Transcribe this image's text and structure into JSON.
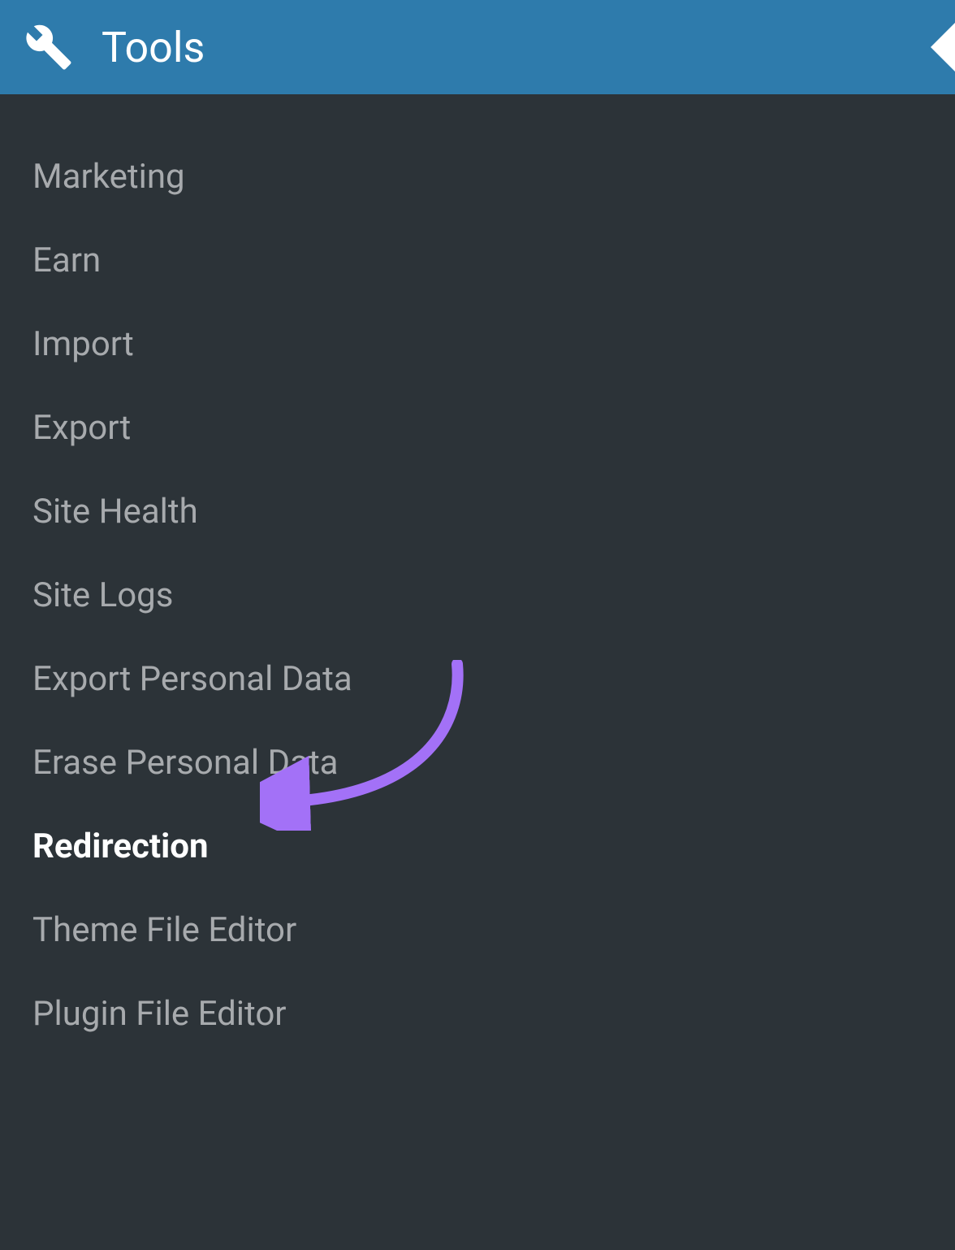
{
  "header": {
    "title": "Tools",
    "icon": "wrench-icon"
  },
  "submenu": {
    "items": [
      {
        "label": "Marketing",
        "active": false
      },
      {
        "label": "Earn",
        "active": false
      },
      {
        "label": "Import",
        "active": false
      },
      {
        "label": "Export",
        "active": false
      },
      {
        "label": "Site Health",
        "active": false
      },
      {
        "label": "Site Logs",
        "active": false
      },
      {
        "label": "Export Personal Data",
        "active": false
      },
      {
        "label": "Erase Personal Data",
        "active": false
      },
      {
        "label": "Redirection",
        "active": true
      },
      {
        "label": "Theme File Editor",
        "active": false
      },
      {
        "label": "Plugin File Editor",
        "active": false
      }
    ]
  },
  "annotation": {
    "arrow_color": "#a371f7"
  }
}
